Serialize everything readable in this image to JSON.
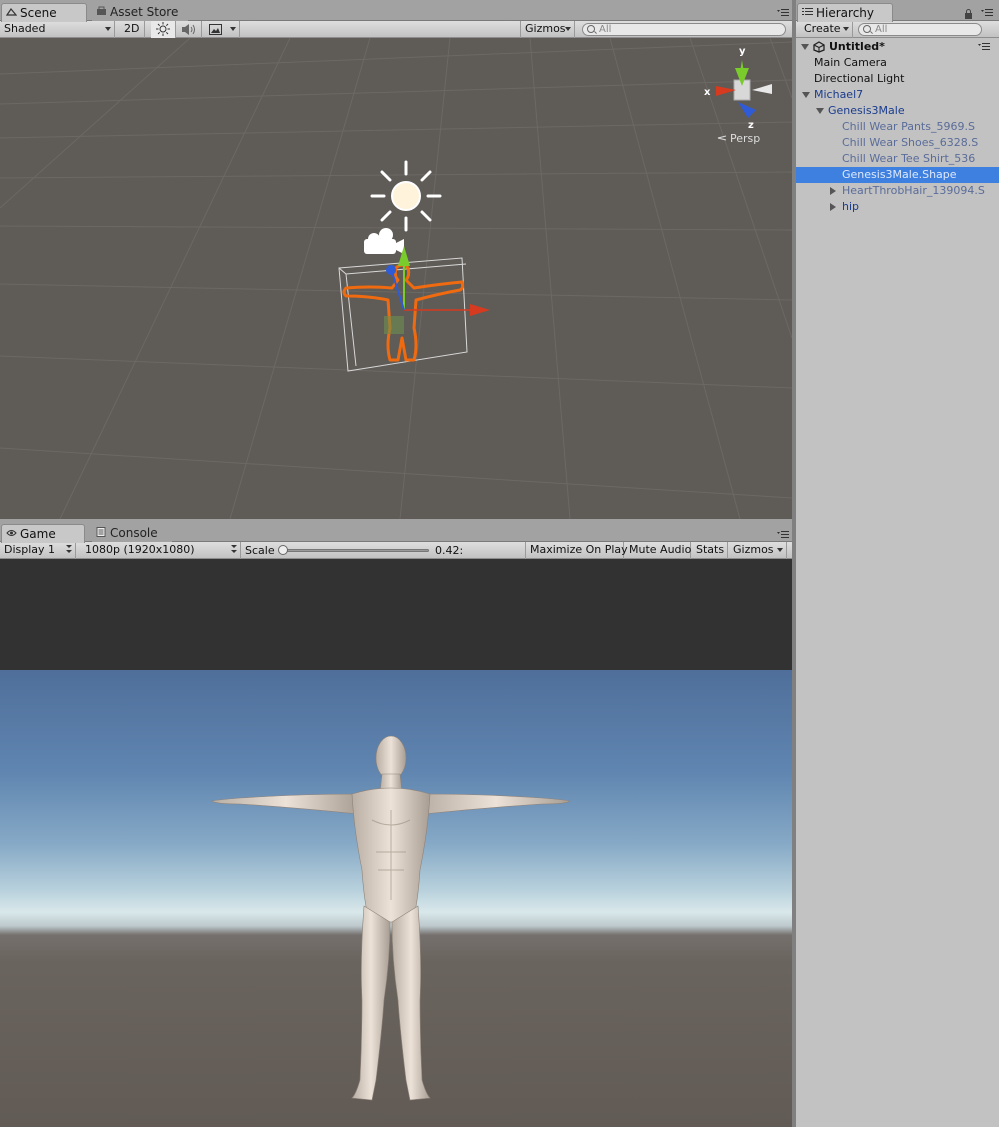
{
  "scene_panel": {
    "tabs": [
      {
        "label": "Scene",
        "icon": "scene-icon",
        "active": true
      },
      {
        "label": "Asset Store",
        "icon": "store-icon",
        "active": false
      }
    ],
    "toolbar": {
      "draw_mode": "Shaded",
      "mode_2d": "2D",
      "lighting_icon": "sun-icon",
      "audio_icon": "speaker-icon",
      "effects_icon": "image-icon",
      "gizmos_label": "Gizmos",
      "search_placeholder": "All"
    },
    "orientation": {
      "y": "y",
      "x": "x",
      "z": "z",
      "projection": "Persp"
    }
  },
  "game_panel": {
    "tabs": [
      {
        "label": "Game",
        "icon": "game-icon",
        "active": true
      },
      {
        "label": "Console",
        "icon": "console-icon",
        "active": false
      }
    ],
    "toolbar": {
      "display": "Display 1",
      "resolution": "1080p (1920x1080)",
      "scale_label": "Scale",
      "scale_value_text": "0.42:",
      "scale_value": 0.0,
      "maximize_on_play": "Maximize On Play",
      "mute_audio": "Mute Audio",
      "stats": "Stats",
      "gizmos": "Gizmos"
    }
  },
  "hierarchy": {
    "tab_label": "Hierarchy",
    "create_label": "Create",
    "search_placeholder": "All",
    "scene_name": "Untitled*",
    "items": [
      {
        "label": "Main Camera",
        "depth": 1,
        "foldout": "none",
        "style": "normal"
      },
      {
        "label": "Directional Light",
        "depth": 1,
        "foldout": "none",
        "style": "normal"
      },
      {
        "label": "Michael7",
        "depth": 1,
        "foldout": "open",
        "style": "prefab"
      },
      {
        "label": "Genesis3Male",
        "depth": 2,
        "foldout": "open",
        "style": "prefab"
      },
      {
        "label": "Chill Wear Pants_5969.S",
        "depth": 3,
        "foldout": "none",
        "style": "prefab-dim"
      },
      {
        "label": "Chill Wear Shoes_6328.S",
        "depth": 3,
        "foldout": "none",
        "style": "prefab-dim"
      },
      {
        "label": "Chill Wear Tee Shirt_536",
        "depth": 3,
        "foldout": "none",
        "style": "prefab-dim"
      },
      {
        "label": "Genesis3Male.Shape",
        "depth": 3,
        "foldout": "none",
        "style": "selected"
      },
      {
        "label": "HeartThrobHair_139094.S",
        "depth": 3,
        "foldout": "closed",
        "style": "prefab-dim"
      },
      {
        "label": "hip",
        "depth": 3,
        "foldout": "closed",
        "style": "prefab"
      }
    ]
  }
}
